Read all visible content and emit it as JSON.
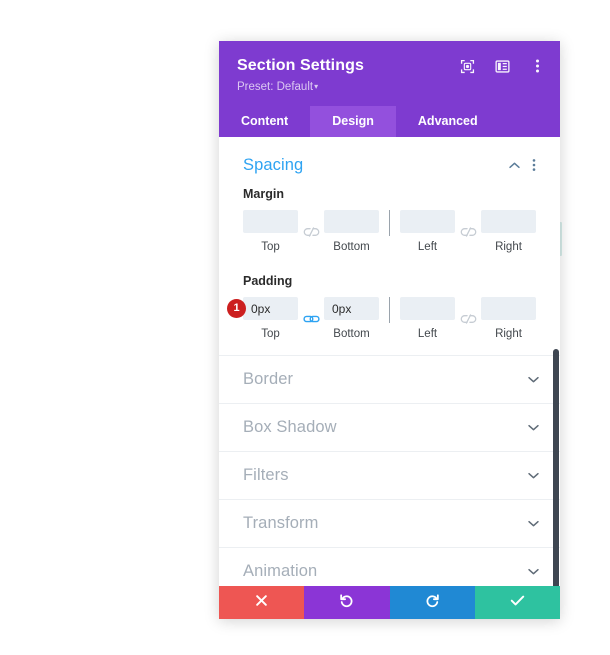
{
  "header": {
    "title": "Section Settings",
    "preset_label": "Preset: Default",
    "preset_caret": "▾",
    "icons": [
      {
        "name": "focus-target-icon",
        "label": "Focus"
      },
      {
        "name": "layout-panel-icon",
        "label": "Panel layout"
      },
      {
        "name": "more-vertical-icon",
        "label": "More options"
      }
    ]
  },
  "tabs": [
    {
      "label": "Content",
      "active": false
    },
    {
      "label": "Design",
      "active": true
    },
    {
      "label": "Advanced",
      "active": false
    }
  ],
  "spacing": {
    "title": "Spacing",
    "collapse_icon": "chevron-up-icon",
    "menu_icon": "more-vertical-icon",
    "margin": {
      "label": "Margin",
      "link_state": "unlinked",
      "fields": [
        {
          "caption": "Top",
          "value": "",
          "placeholder": ""
        },
        {
          "caption": "Bottom",
          "value": "",
          "placeholder": ""
        },
        {
          "caption": "Left",
          "value": "",
          "placeholder": ""
        },
        {
          "caption": "Right",
          "value": "",
          "placeholder": ""
        }
      ]
    },
    "padding": {
      "label": "Padding",
      "badge": "1",
      "link_state_first_pair": "linked",
      "link_state_second_pair": "unlinked",
      "fields": [
        {
          "caption": "Top",
          "value": "0px",
          "placeholder": ""
        },
        {
          "caption": "Bottom",
          "value": "0px",
          "placeholder": ""
        },
        {
          "caption": "Left",
          "value": "",
          "placeholder": ""
        },
        {
          "caption": "Right",
          "value": "",
          "placeholder": ""
        }
      ]
    }
  },
  "collapsed_sections": [
    {
      "label": "Border"
    },
    {
      "label": "Box Shadow"
    },
    {
      "label": "Filters"
    },
    {
      "label": "Transform"
    },
    {
      "label": "Animation"
    }
  ],
  "footer": [
    {
      "name": "cancel-button",
      "icon": "close-icon",
      "label": "✖"
    },
    {
      "name": "undo-button",
      "icon": "undo-icon",
      "label": "↺"
    },
    {
      "name": "redo-button",
      "icon": "redo-icon",
      "label": "↻"
    },
    {
      "name": "save-button",
      "icon": "check-icon",
      "label": "✔"
    }
  ],
  "colors": {
    "header_purple": "#7e3bd0",
    "tab_active_purple": "#9350dd",
    "section_title_blue": "#2ea3f2",
    "input_bg": "#eaeff4",
    "badge_red": "#cc1f1f",
    "link_active_blue": "#2ea3f2",
    "scrollbar_thumb": "#3e4651",
    "footer_cancel": "#ee5653",
    "footer_undo": "#8b35d6",
    "footer_redo": "#2089d4",
    "footer_save": "#2ec2a0"
  }
}
